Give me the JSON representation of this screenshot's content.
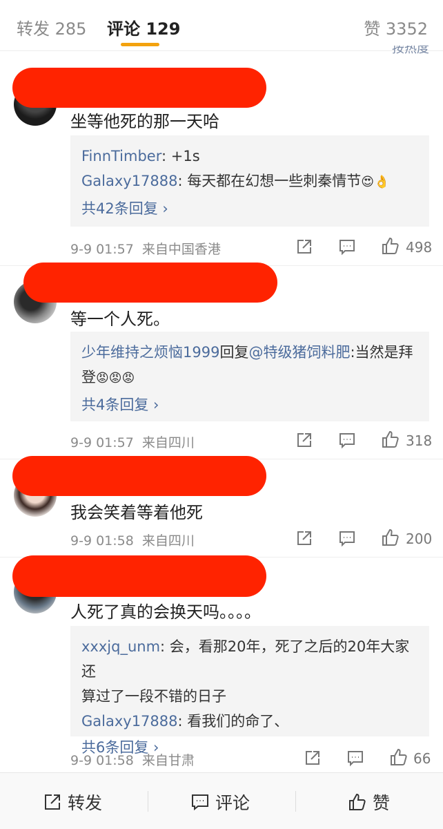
{
  "tabs": {
    "reposts": "转发 285",
    "comments": "评论 129",
    "likes": "赞 3352"
  },
  "sort_label": "按热度",
  "comments": [
    {
      "text": "坐等他死的那一天哈",
      "replies": [
        {
          "user": "FinnTimber",
          "text": ": +1s"
        },
        {
          "user": "Galaxy17888",
          "text": ": 每天都在幻想一些刺秦情节",
          "emoji": "😍👌"
        }
      ],
      "more": "共42条回复 ›",
      "time": "9-9 01:57",
      "source": "来自中国香港",
      "likes": "498"
    },
    {
      "text": "等一个人死。",
      "replies": [
        {
          "user": "少年维持之烦恼1999",
          "text_a": "回复",
          "mention": "@特级猪饲料肥",
          "text": ":当然是拜",
          "text2": "登",
          "emoji": "😡😡😡"
        }
      ],
      "more": "共4条回复 ›",
      "time": "9-9 01:57",
      "source": "来自四川",
      "likes": "318"
    },
    {
      "text": "我会笑着等着他死",
      "time": "9-9 01:58",
      "source": "来自四川",
      "likes": "200"
    },
    {
      "text": "人死了真的会换天吗。。。。",
      "replies": [
        {
          "user": "xxxjq_unm",
          "text": ": 会，看那20年，死了之后的20年大家还",
          "text2": "算过了一段不错的日子"
        },
        {
          "user": "Galaxy17888",
          "text": ": 看我们的命了、"
        }
      ],
      "more": "共6条回复 ›",
      "time": "9-9 01:58",
      "source": "来自甘肃",
      "likes": "66"
    }
  ],
  "bottom": {
    "repost": "转发",
    "comment": "评论",
    "like": "赞"
  },
  "colors": {
    "accent": "#f3a20e",
    "link": "#4b6b9c",
    "redaction": "#ff2300"
  }
}
